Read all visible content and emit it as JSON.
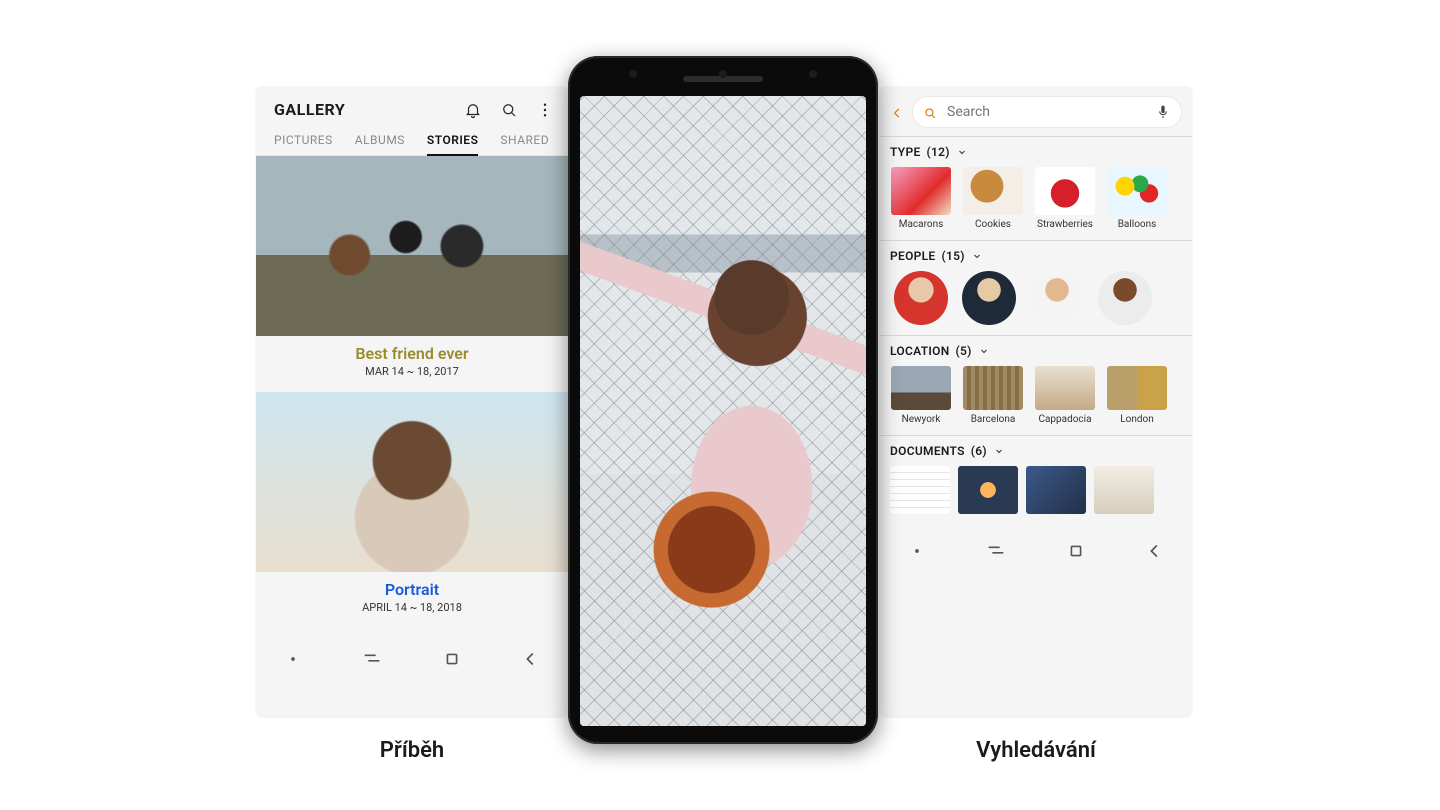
{
  "captions": {
    "left": "Příběh",
    "right": "Vyhledávání"
  },
  "gallery": {
    "title": "GALLERY",
    "tabs": {
      "pictures": "PICTURES",
      "albums": "ALBUMS",
      "stories": "STORIES",
      "shared": "SHARED"
    },
    "stories": [
      {
        "title": "Best friend ever",
        "date": "MAR 14 ~ 18, 2017"
      },
      {
        "title": "Portrait",
        "date": "APRIL 14 ~ 18, 2018"
      }
    ]
  },
  "search": {
    "placeholder": "Search",
    "sections": {
      "type": {
        "label": "TYPE",
        "count": "(12)",
        "items": [
          "Macarons",
          "Cookies",
          "Strawberries",
          "Balloons"
        ]
      },
      "people": {
        "label": "PEOPLE",
        "count": "(15)"
      },
      "location": {
        "label": "LOCATION",
        "count": "(5)",
        "items": [
          "Newyork",
          "Barcelona",
          "Cappadocia",
          "London"
        ]
      },
      "documents": {
        "label": "DOCUMENTS",
        "count": "(6)"
      }
    }
  }
}
